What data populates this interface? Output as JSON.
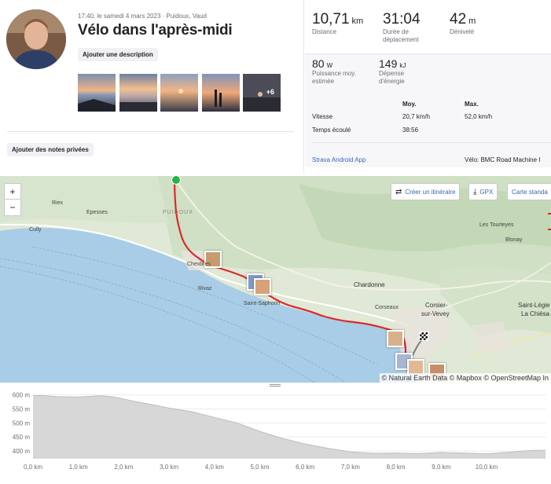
{
  "activity": {
    "meta": "17:40, le samedi 4 mars 2023 · Puidoux, Vaud",
    "title": "Vélo dans l'après-midi",
    "add_description": "Ajouter une description",
    "add_notes": "Ajouter des notes privées",
    "photos_more": "+6"
  },
  "stats": {
    "distance": {
      "value": "10,71",
      "unit": "km",
      "label": "Distance"
    },
    "moving_time": {
      "value": "31:04",
      "label1": "Durée de",
      "label2": "déplacement"
    },
    "elevation": {
      "value": "42",
      "unit": "m",
      "label": "Dénivelé"
    },
    "power": {
      "value": "80",
      "unit": "W",
      "label1": "Puissance moy.",
      "label2": "estimée"
    },
    "energy": {
      "value": "149",
      "unit": "kJ",
      "label1": "Dépense",
      "label2": "d'énergie"
    }
  },
  "table": {
    "col_avg": "Moy.",
    "col_max": "Max.",
    "rows": [
      {
        "label": "Vitesse",
        "avg": "20,7 km/h",
        "max": "52,0 km/h"
      },
      {
        "label": "Temps écoulé",
        "avg": "38:56",
        "max": ""
      }
    ]
  },
  "footer": {
    "app": "Strava Android App",
    "bike": "Vélo: BMC Road Machine I"
  },
  "map": {
    "zoom_in": "+",
    "zoom_out": "−",
    "create_route": "Créer un itinéraire",
    "gpx": "GPX",
    "map_type": "Carte standa",
    "attribution": "© Natural Earth Data © Mapbox © OpenStreetMap In",
    "places": {
      "rex": "Riex",
      "epesses": "Epesses",
      "puidoux": "PUIDOUX",
      "cully": "Cully",
      "chexbres": "Chexbres",
      "rivaz": "Rivaz",
      "st_saphorin": "Saint-Saphorin",
      "chardonne": "Chardonne",
      "corseaux": "Corseaux",
      "corsier1": "Corsier-",
      "corsier2": "sur-Vevey",
      "tourteyes": "Les Tourteyes",
      "blonay": "Blonay",
      "st_legier1": "Saint-Légie",
      "st_legier2": "La Chiésa"
    }
  },
  "elevation_chart": {
    "type": "area",
    "y_ticks": [
      "600 m",
      "550 m",
      "500 m",
      "450 m",
      "400 m"
    ],
    "x_ticks": [
      "0,0 km",
      "1,0 km",
      "2,0 km",
      "3,0 km",
      "4,0 km",
      "5,0 km",
      "6,0 km",
      "7,0 km",
      "8,0 km",
      "9,0 km",
      "10,0 km"
    ],
    "ylim": [
      375,
      610
    ],
    "xlim": [
      0,
      11.3
    ],
    "profile_km": [
      0,
      0.2,
      0.5,
      1.0,
      1.5,
      1.8,
      2.2,
      2.6,
      3.0,
      3.5,
      4.0,
      4.5,
      5.0,
      5.5,
      6.0,
      6.5,
      7.0,
      7.5,
      8.0,
      8.5,
      9.0,
      9.5,
      10.0,
      10.5,
      11.0,
      11.3
    ],
    "profile_m": [
      597,
      598,
      594,
      592,
      597,
      592,
      578,
      566,
      553,
      540,
      520,
      500,
      470,
      445,
      425,
      410,
      397,
      392,
      393,
      391,
      395,
      393,
      390,
      396,
      402,
      403
    ]
  },
  "colors": {
    "accent": "#3768b8",
    "route": "#e0282d",
    "start": "#28b446",
    "lake": "#a9cde6",
    "profile_fill": "#d7d7d7"
  }
}
